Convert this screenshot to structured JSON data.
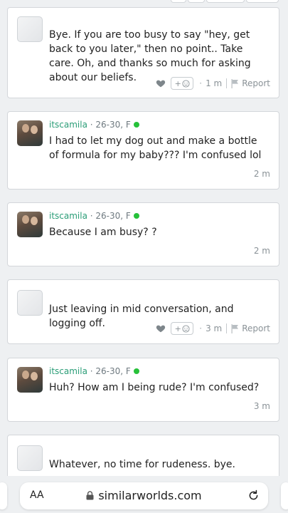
{
  "posts": [
    {
      "kind": "other",
      "text": "Bye. If you are too busy to say \"hey, get back to you later,\" then no point.. Take care. Oh, and thanks so much for asking about our beliefs.",
      "react_label": "+",
      "time": "1 m",
      "report_label": "Report"
    },
    {
      "kind": "self",
      "username": "itscamila",
      "meta": "· 26-30, F",
      "text": "I had to let my dog out and make a bottle of formula for my baby??? I'm confused lol",
      "time": "2 m"
    },
    {
      "kind": "self",
      "username": "itscamila",
      "meta": "· 26-30, F",
      "text": "Because I am busy? ?",
      "time": "2 m"
    },
    {
      "kind": "other",
      "text": "Just leaving in mid conversation, and logging off.",
      "react_label": "+",
      "time": "3 m",
      "report_label": "Report"
    },
    {
      "kind": "self",
      "username": "itscamila",
      "meta": "· 26-30, F",
      "text": "Huh? How am I being rude? I'm confused?",
      "time": "3 m"
    },
    {
      "kind": "other",
      "text": "Whatever, no time for rudeness. bye."
    }
  ],
  "browser": {
    "text_size_label": "AA",
    "url": "similarworlds.com"
  },
  "colors": {
    "username": "#2a9d77",
    "online": "#27c13a",
    "background": "#eef0f2"
  }
}
